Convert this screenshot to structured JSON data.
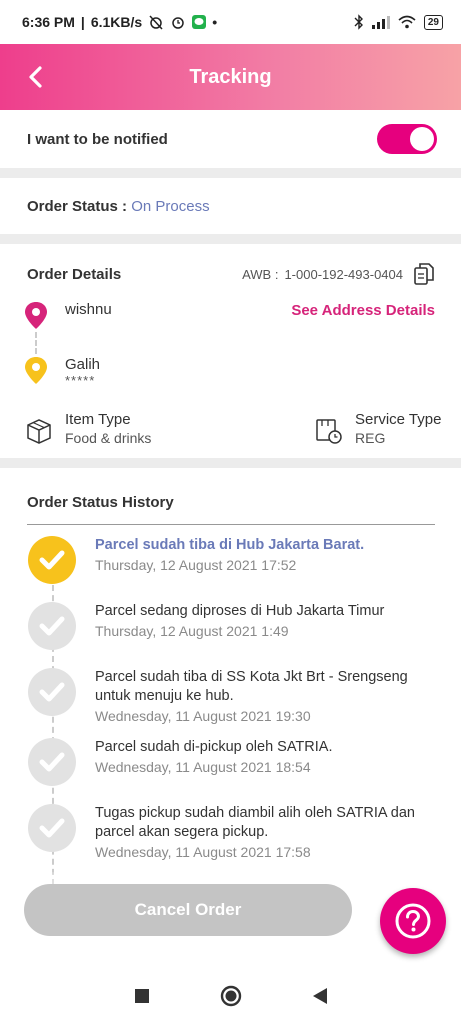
{
  "status_bar": {
    "time": "6:36 PM",
    "speed": "6.1KB/s",
    "battery": "29"
  },
  "header": {
    "title": "Tracking"
  },
  "notify": {
    "label": "I want to be notified",
    "enabled": true
  },
  "order_status": {
    "label": "Order Status :",
    "value": "On Process"
  },
  "order_details": {
    "title": "Order Details",
    "awb_label": "AWB :",
    "awb_number": "1-000-192-493-0404",
    "sender": {
      "name": "wishnu"
    },
    "see_address_label": "See Address Details",
    "receiver": {
      "name": "Galih",
      "detail": "*****"
    },
    "item_type_label": "Item Type",
    "item_type_value": "Food & drinks",
    "service_type_label": "Service Type",
    "service_type_value": "REG"
  },
  "history": {
    "title": "Order Status History",
    "items": [
      {
        "title": "Parcel sudah tiba di Hub Jakarta Barat.",
        "date": "Thursday, 12 August 2021 17:52"
      },
      {
        "title": "Parcel sedang diproses di Hub Jakarta Timur",
        "date": "Thursday, 12 August 2021 1:49"
      },
      {
        "title": "Parcel sudah tiba di SS Kota Jkt Brt - Srengseng untuk menuju ke hub.",
        "date": "Wednesday, 11 August 2021 19:30"
      },
      {
        "title": "Parcel sudah di-pickup oleh SATRIA.",
        "date": "Wednesday, 11 August 2021 18:54"
      },
      {
        "title": "Tugas pickup sudah diambil alih oleh SATRIA dan parcel akan segera pickup.",
        "date": "Wednesday, 11 August 2021 17:58"
      }
    ]
  },
  "cancel_button": {
    "label": "Cancel Order"
  },
  "colors": {
    "brand": "#e6007e",
    "accent_blue": "#6a7ab8",
    "active_check": "#f7c21c",
    "disabled": "#c4c4c4"
  }
}
